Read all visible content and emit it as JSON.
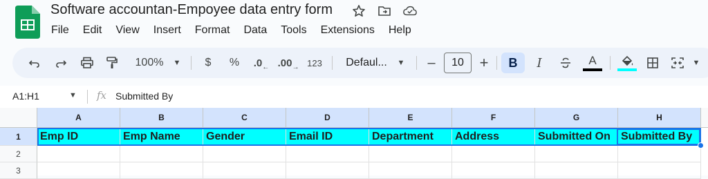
{
  "document": {
    "title": "Software accountan-Empoyee data entry form",
    "icons": [
      "star-icon",
      "move-to-folder-icon",
      "cloud-saved-icon"
    ]
  },
  "menu": [
    "File",
    "Edit",
    "View",
    "Insert",
    "Format",
    "Data",
    "Tools",
    "Extensions",
    "Help"
  ],
  "toolbar": {
    "zoom": "100%",
    "currency": "$",
    "percent": "%",
    "decrease_decimal": ".0",
    "increase_decimal": ".00",
    "number_format": "123",
    "font": "Defaul...",
    "font_size": "10",
    "minus": "–",
    "plus": "+",
    "bold": "B",
    "italic": "I",
    "text_color": "A",
    "text_color_hex": "#000000",
    "fill_color_hex": "#00ffff",
    "bold_active": true
  },
  "formula_bar": {
    "name_box": "A1:H1",
    "fx": "fx",
    "content": "Submitted By"
  },
  "sheet": {
    "columns": [
      "A",
      "B",
      "C",
      "D",
      "E",
      "F",
      "G",
      "H"
    ],
    "rows": [
      "1",
      "2",
      "3"
    ],
    "header_row": [
      "Emp ID",
      "Emp Name",
      "Gender",
      "Email ID",
      "Department",
      "Address",
      "Submitted On",
      "Submitted By"
    ],
    "header_fill": "#00ffff",
    "selection": "A1:H1"
  }
}
